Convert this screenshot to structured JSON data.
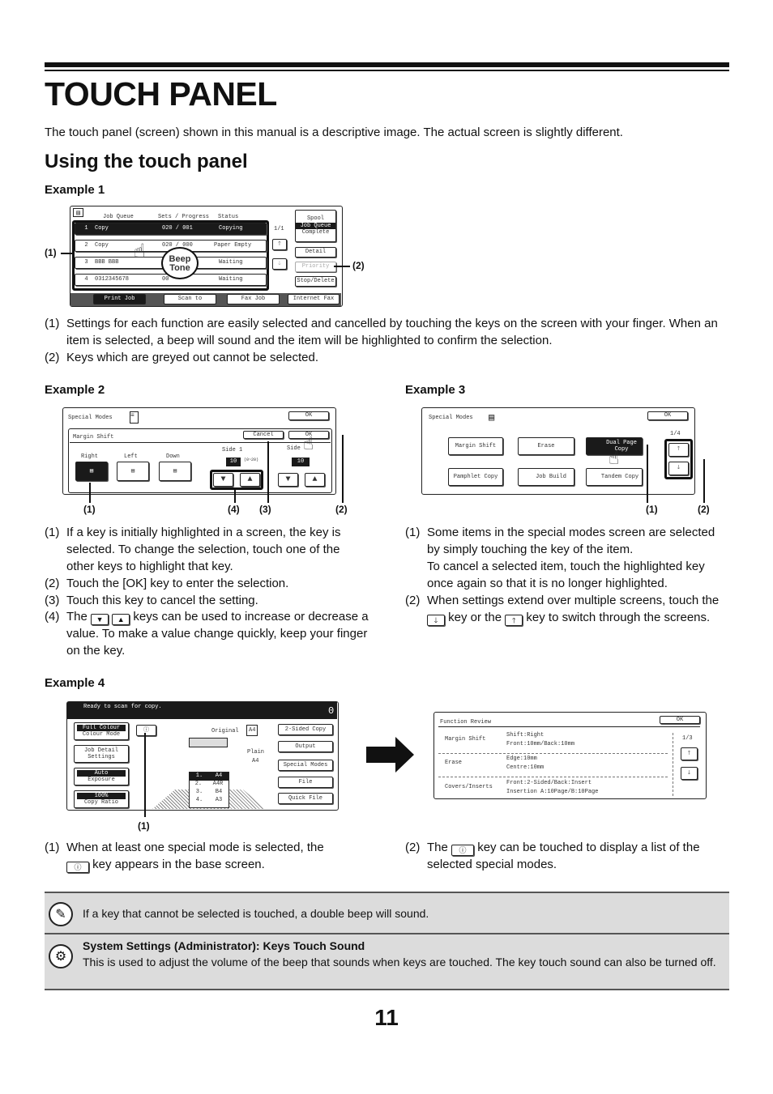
{
  "title": "TOUCH PANEL",
  "intro": "The touch panel (screen) shown in this manual is a descriptive image. The actual screen is slightly different.",
  "section_title": "Using the touch panel",
  "example1": {
    "heading": "Example 1",
    "screen": {
      "columns": [
        "Job Queue",
        "Sets / Progress",
        "Status"
      ],
      "rows": [
        {
          "num": "1",
          "name": "Copy",
          "progress": "020 / 001",
          "status": "Copying"
        },
        {
          "num": "2",
          "name": "Copy",
          "progress": "020 / 000",
          "status": "Paper Empty"
        },
        {
          "num": "3",
          "name": "BBB BBB",
          "progress": "0",
          "status": "Waiting"
        },
        {
          "num": "4",
          "name": "0312345678",
          "progress": "00",
          "status": "Waiting"
        }
      ],
      "page": "1/1",
      "spool": "Spool",
      "job_queue": "Job Queue",
      "complete": "Complete",
      "detail": "Detail",
      "priority": "Priority",
      "stop_delete": "Stop/Delete",
      "tabs": [
        "Print Job",
        "Scan to",
        "Fax Job",
        "Internet Fax"
      ],
      "beep": "Beep Tone"
    },
    "callouts": [
      "(1)",
      "(2)"
    ],
    "items": [
      {
        "n": "(1)",
        "t": "Settings for each function are easily selected and cancelled by touching the keys on the screen with your finger. When an item is selected, a beep will sound and the item will be highlighted to confirm the selection."
      },
      {
        "n": "(2)",
        "t": "Keys which are greyed out cannot be selected."
      }
    ]
  },
  "example2": {
    "heading": "Example 2",
    "screen": {
      "title": "Special Modes",
      "ok": "OK",
      "panel": "Margin Shift",
      "cancel": "Cancel",
      "ok2": "OK",
      "right": "Right",
      "left": "Left",
      "down": "Down",
      "side1": "Side 1",
      "side2": "Side",
      "value1": "10",
      "value2": "10",
      "range": "(0~20)",
      "unit": "mm"
    },
    "callouts": [
      "(1)",
      "(4)",
      "(3)",
      "(2)"
    ],
    "items": [
      {
        "n": "(1)",
        "t": "If a key is initially highlighted in a screen, the key is selected. To change the selection, touch one of the other keys to highlight that key."
      },
      {
        "n": "(2)",
        "t": "Touch the [OK] key to enter the selection."
      },
      {
        "n": "(3)",
        "t": "Touch this key to cancel the setting."
      },
      {
        "n": "(4)",
        "t_before": "The",
        "t_after": "keys can be used to increase or decrease a value. To make a value change quickly, keep your finger on the key."
      }
    ]
  },
  "example3": {
    "heading": "Example 3",
    "screen": {
      "title": "Special Modes",
      "ok": "OK",
      "keys": [
        "Margin Shift",
        "Erase",
        "Dual Page Copy",
        "Pamphlet Copy",
        "Job Build",
        "Tandem Copy"
      ],
      "page": "1/4"
    },
    "callouts": [
      "(1)",
      "(2)"
    ],
    "items": [
      {
        "n": "(1)",
        "t": "Some items in the special modes screen are selected by simply touching the key of the item.",
        "t2": "To cancel a selected item, touch the highlighted key once again so that it is no longer highlighted."
      },
      {
        "n": "(2)",
        "t_before": "When settings extend over multiple screens, touch the",
        "t_mid": "key or the",
        "t_after": "key to switch through the screens."
      }
    ]
  },
  "example4": {
    "heading": "Example 4",
    "screen": {
      "status": "Ready to scan for copy.",
      "count": "0",
      "colour": "Full Colour",
      "colour_mode": "Colour Mode",
      "job_detail": "Job Detail Settings",
      "auto": "Auto",
      "exposure": "Exposure",
      "ratio": "100%",
      "copy_ratio": "Copy Ratio",
      "original": "Original",
      "orig_size": "A4",
      "plain": "Plain",
      "plain_size": "A4",
      "trays": [
        {
          "n": "1.",
          "s": "A4"
        },
        {
          "n": "2.",
          "s": "A4R"
        },
        {
          "n": "3.",
          "s": "B4"
        },
        {
          "n": "4.",
          "s": "A3"
        }
      ],
      "right_keys": [
        "2-Sided Copy",
        "Output",
        "Special Modes",
        "File",
        "Quick File"
      ]
    },
    "review": {
      "title": "Function Review",
      "ok": "OK",
      "page": "1/3",
      "rows": [
        {
          "name": "Margin Shift",
          "l1": "Shift:Right",
          "l2": "Front:10mm/Back:10mm"
        },
        {
          "name": "Erase",
          "l1": "Edge:10mm",
          "l2": "Centre:10mm"
        },
        {
          "name": "Covers/Inserts",
          "l1": "Front:2-Sided/Back:Insert",
          "l2": "Insertion A:10Page/B:10Page"
        }
      ]
    },
    "callouts": [
      "(1)"
    ],
    "item1": {
      "n": "(1)",
      "t_before": "When at least one special mode is selected, the",
      "t_after": "key appears in the base screen."
    },
    "item2": {
      "n": "(2)",
      "t_before": "The",
      "t_after": "key can be touched to display a list of the selected special modes."
    }
  },
  "note": {
    "icon": "note-pencil-icon",
    "text": "If a key that cannot be selected is touched, a double beep will sound."
  },
  "settings": {
    "icon": "gears-icon",
    "title": "System Settings (Administrator): Keys Touch Sound",
    "text": "This is used to adjust the volume of the beep that sounds when keys are touched. The key touch sound can also be turned off."
  },
  "page_number": "11"
}
